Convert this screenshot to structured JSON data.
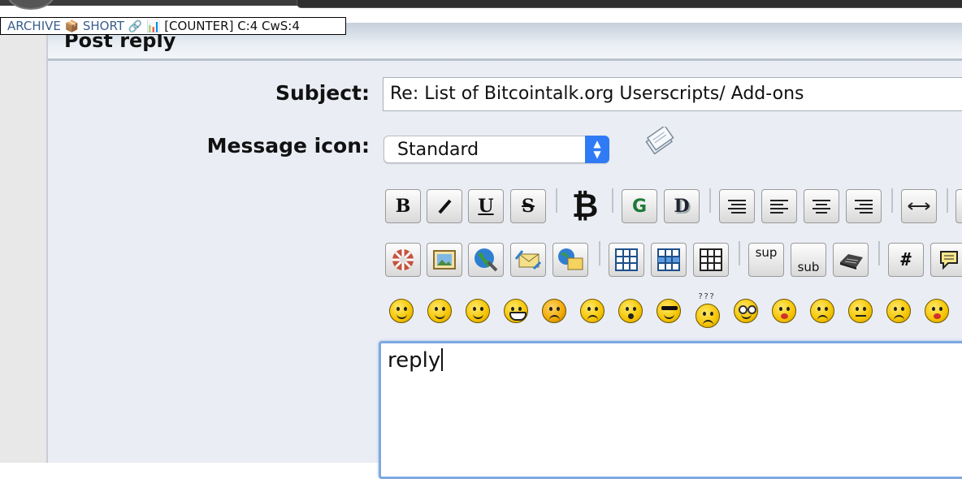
{
  "extension_badge": {
    "archive": "ARCHIVE",
    "archive_icon": "📦",
    "short": "SHORT",
    "short_icon": "🔗",
    "counter_icon": "📊",
    "counter": "[COUNTER] C:4 CwS:4"
  },
  "post": {
    "title": "Post reply"
  },
  "form": {
    "subject_label": "Subject:",
    "subject_value": "Re: List of Bitcointalk.org Userscripts/ Add-ons",
    "icon_label": "Message icon:",
    "icon_value": "Standard",
    "message_value": "reply"
  },
  "toolbar": {
    "bold": "B",
    "italic": "I",
    "underline": "U",
    "strike": "S",
    "bitcoin": "₿",
    "glow": "G",
    "shadow": "D",
    "sup": "sup",
    "sub": "sub",
    "code": "#"
  },
  "icons": {
    "row1": [
      "bold-icon",
      "italic-icon",
      "underline-icon",
      "strikethrough-icon",
      "bitcoin-icon",
      "glow-icon",
      "shadow-icon",
      "pre-icon",
      "left-align-icon",
      "center-icon",
      "right-align-icon",
      "horizontal-rule-icon"
    ],
    "row2": [
      "flash-icon",
      "image-icon",
      "hyperlink-icon",
      "email-icon",
      "ftp-icon",
      "table-icon",
      "table-row-icon",
      "table-column-icon",
      "superscript-icon",
      "subscript-icon",
      "teletype-icon",
      "code-icon",
      "quote-icon"
    ],
    "smileys": [
      "smiley",
      "wink",
      "cheesy",
      "grin",
      "angry",
      "sad",
      "shocked",
      "cool",
      "huh",
      "roll-eyes",
      "tongue",
      "embarrassed",
      "lips-sealed",
      "undecided",
      "kiss"
    ]
  },
  "colors": {
    "accent": "#2f7bf5",
    "header": "#c5d0dc",
    "panel": "#eaedf3",
    "focus": "#7fa8e3"
  }
}
